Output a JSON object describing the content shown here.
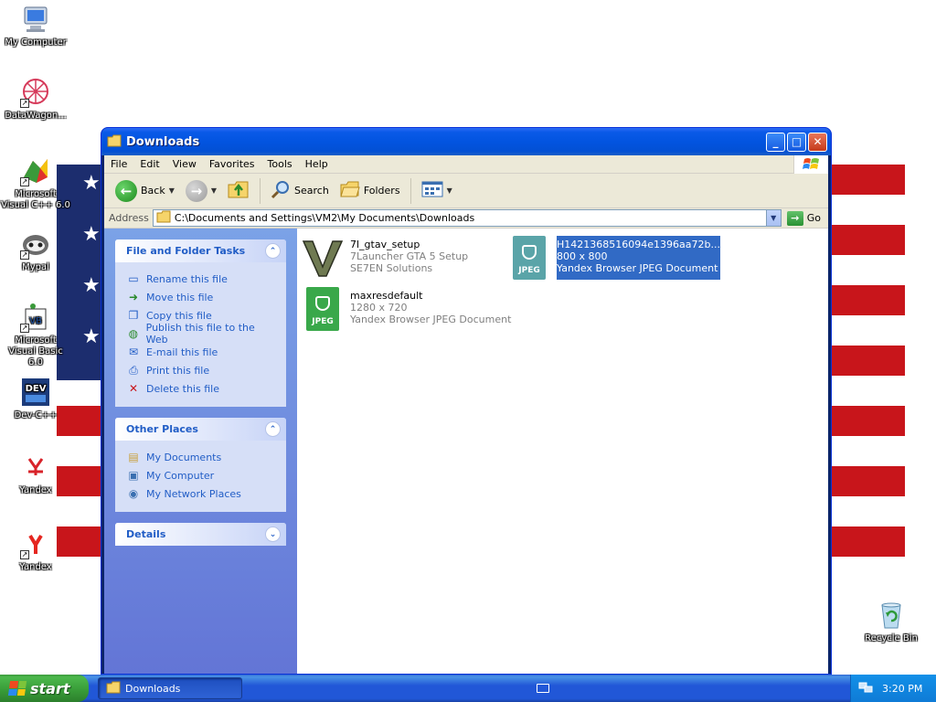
{
  "desktop": {
    "icons": [
      {
        "label": "My Computer",
        "icon": "my-computer-icon"
      },
      {
        "label": "DataWagon...",
        "icon": "datawagon-icon"
      },
      {
        "label": "Microsoft Visual C++ 6.0",
        "icon": "visual-cpp-icon"
      },
      {
        "label": "Mypal",
        "icon": "mypal-icon"
      },
      {
        "label": "Microsoft Visual Basic 6.0",
        "icon": "visual-basic-icon"
      },
      {
        "label": "Dev-C++",
        "icon": "dev-cpp-icon"
      },
      {
        "label": "Yandex",
        "icon": "yandex-icon"
      },
      {
        "label": "Yandex",
        "icon": "yandex-browser-icon"
      },
      {
        "label": "Recycle Bin",
        "icon": "recycle-bin-icon"
      }
    ]
  },
  "window": {
    "title": "Downloads",
    "menu": [
      "File",
      "Edit",
      "View",
      "Favorites",
      "Tools",
      "Help"
    ],
    "toolbar": {
      "back_label": "Back",
      "search_label": "Search",
      "folders_label": "Folders"
    },
    "address": {
      "label": "Address",
      "value": "C:\\Documents and Settings\\VM2\\My Documents\\Downloads",
      "go_label": "Go"
    },
    "sidebar": {
      "file_tasks": {
        "title": "File and Folder Tasks",
        "items": [
          "Rename this file",
          "Move this file",
          "Copy this file",
          "Publish this file to the Web",
          "E-mail this file",
          "Print this file",
          "Delete this file"
        ]
      },
      "other_places": {
        "title": "Other Places",
        "items": [
          "My Documents",
          "My Computer",
          "My Network Places"
        ]
      },
      "details": {
        "title": "Details"
      }
    },
    "files": [
      {
        "name": "7l_gtav_setup",
        "line2": "7Launcher GTA 5 Setup",
        "line3": "SE7EN Solutions",
        "selected": false
      },
      {
        "name": "H1421368516094e1396aa72b...",
        "line2": "800 x 800",
        "line3": "Yandex Browser JPEG Document",
        "selected": true
      },
      {
        "name": "maxresdefault",
        "line2": "1280 x 720",
        "line3": "Yandex Browser JPEG Document",
        "selected": false
      }
    ],
    "jpeg_badge": "JPEG"
  },
  "taskbar": {
    "start_label": "start",
    "task_label": "Downloads",
    "clock": "3:20 PM"
  }
}
